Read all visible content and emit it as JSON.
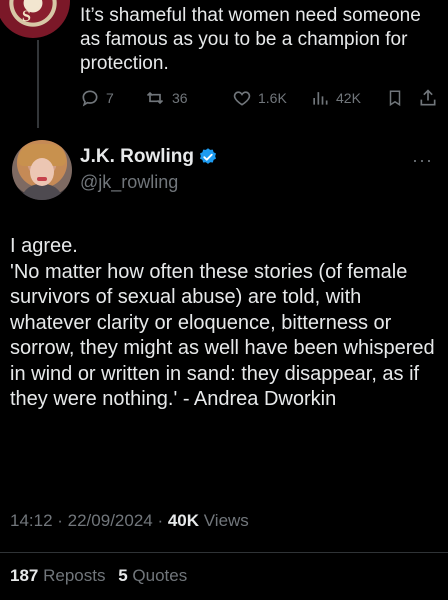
{
  "reply": {
    "text": "It’s shameful that women need someone as famous as you to be a champion for protection.",
    "actions": {
      "replies": "7",
      "reposts": "36",
      "likes": "1.6K",
      "views": "42K"
    }
  },
  "tweet": {
    "author_name": "J.K. Rowling",
    "handle": "@jk_rowling",
    "body": "I agree.\n'No matter how often these stories (of female survivors of sexual abuse) are told, with whatever clarity or eloquence, bitterness or sorrow, they might as well have been whispered in wind or written in sand: they disappear, as if they were nothing.' - Andrea Dworkin",
    "time": "14:12 · 22/09/2024 · ",
    "views_count": "40K",
    "views_label": " Views",
    "reposts_count": "187",
    "reposts_label": " Reposts",
    "quotes_count": "5",
    "quotes_label": " Quotes"
  },
  "colors": {
    "background": "#000000",
    "text": "#e7e9ea",
    "secondary": "#71767b",
    "verified": "#1d9bf0"
  },
  "icons": [
    "reply-icon",
    "repost-icon",
    "like-icon",
    "views-icon",
    "bookmark-icon",
    "share-icon",
    "verified-badge-icon",
    "more-options-icon"
  ]
}
